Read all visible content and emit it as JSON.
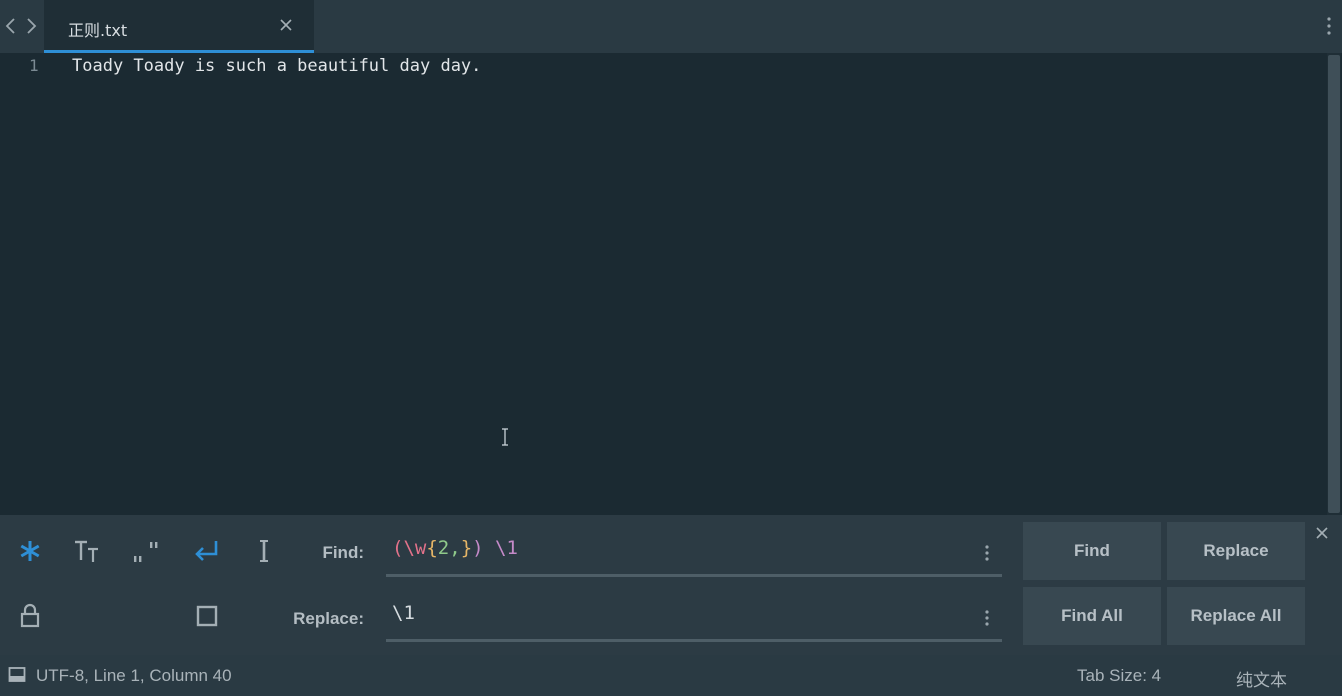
{
  "tab": {
    "title": "正则.txt"
  },
  "editor": {
    "line_number": "1",
    "line_text": "Toady Toady is such a beautiful day day."
  },
  "find_panel": {
    "find_label": "Find:",
    "replace_label": "Replace:",
    "find_tokens": [
      {
        "text": "(",
        "color": "#e2728a"
      },
      {
        "text": "\\w",
        "color": "#e2728a"
      },
      {
        "text": "{",
        "color": "#e5b567"
      },
      {
        "text": "2,",
        "color": "#8fc98a"
      },
      {
        "text": "}",
        "color": "#e5b567"
      },
      {
        "text": ")",
        "color": "#c58ac9"
      },
      {
        "text": " ",
        "color": "#c9d2d8"
      },
      {
        "text": "\\1",
        "color": "#c58ac9"
      }
    ],
    "replace_value": "\\1",
    "buttons": {
      "find": "Find",
      "replace": "Replace",
      "find_all": "Find All",
      "replace_all": "Replace All"
    },
    "accent_color": "#2e8fd6"
  },
  "status": {
    "position": "UTF-8, Line 1, Column 40",
    "tab_size": "Tab Size: 4",
    "syntax": "纯文本"
  }
}
